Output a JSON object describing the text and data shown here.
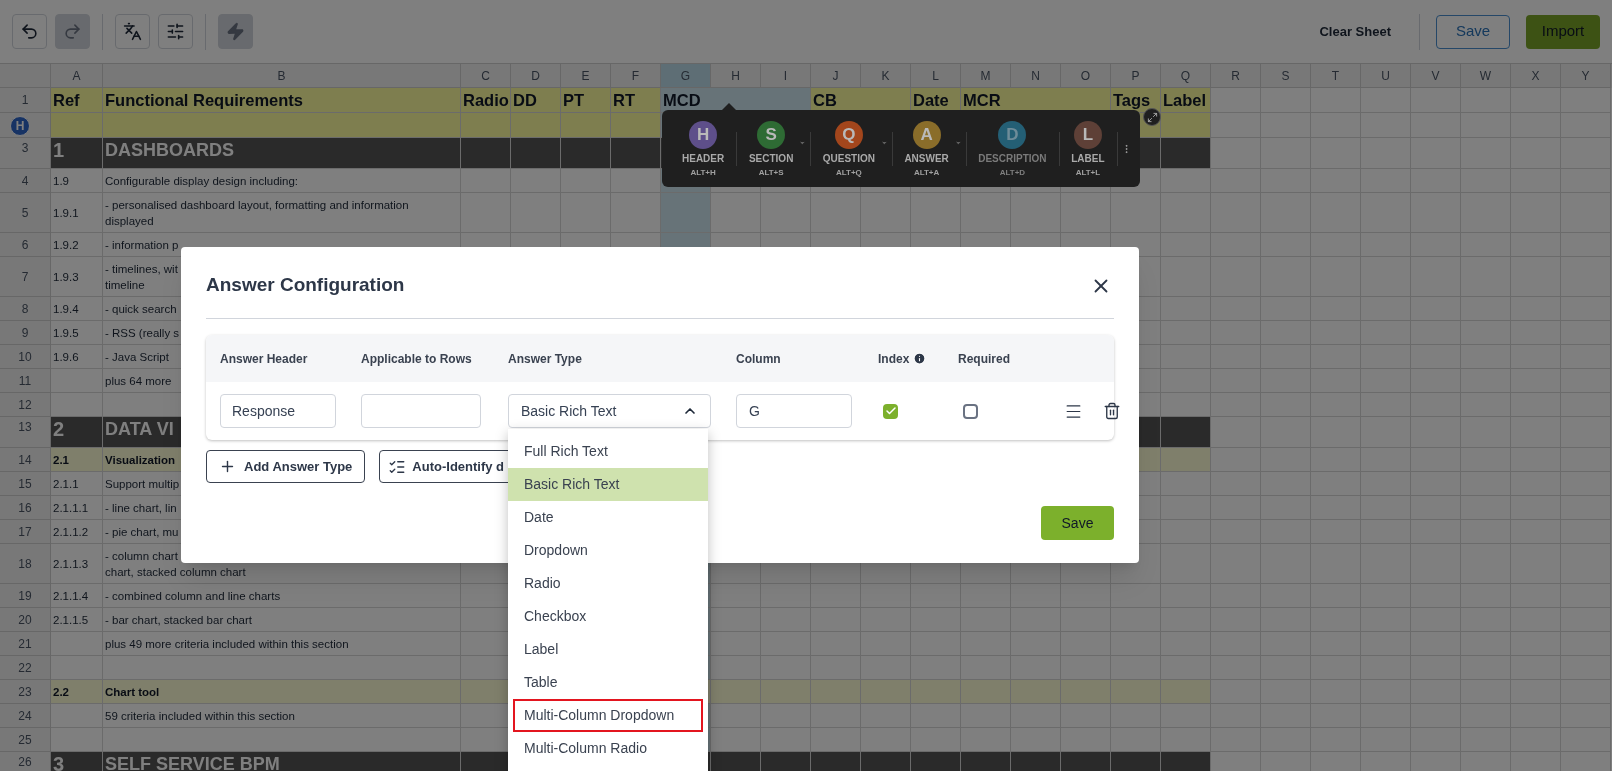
{
  "toolbar": {
    "tools": [
      {
        "kind": "undo",
        "disabled": false
      },
      {
        "kind": "redo",
        "disabled": true
      },
      {
        "kind": "translate",
        "disabled": false
      },
      {
        "kind": "settings",
        "disabled": false
      },
      {
        "kind": "automate",
        "disabled": true
      }
    ],
    "actions": [
      {
        "label": "Clear Sheet",
        "kind": "text"
      },
      {
        "label": "Save",
        "kind": "outline"
      },
      {
        "label": "Import",
        "kind": "primary"
      }
    ]
  },
  "spreadsheet": {
    "columns": [
      {
        "label": "A",
        "selected": false
      },
      {
        "label": "B",
        "selected": false
      },
      {
        "label": "C",
        "selected": false
      },
      {
        "label": "D",
        "selected": false
      },
      {
        "label": "E",
        "selected": false
      },
      {
        "label": "F",
        "selected": false
      },
      {
        "label": "G",
        "selected": true
      },
      {
        "label": "H",
        "selected": false
      },
      {
        "label": "I",
        "selected": false
      },
      {
        "label": "J",
        "selected": false
      },
      {
        "label": "K",
        "selected": false
      },
      {
        "label": "L",
        "selected": false
      },
      {
        "label": "M",
        "selected": false
      },
      {
        "label": "N",
        "selected": false
      },
      {
        "label": "O",
        "selected": false
      },
      {
        "label": "P",
        "selected": false
      },
      {
        "label": "Q",
        "selected": false
      },
      {
        "label": "R",
        "selected": false
      },
      {
        "label": "S",
        "selected": false
      },
      {
        "label": "T",
        "selected": false
      },
      {
        "label": "U",
        "selected": false
      },
      {
        "label": "V",
        "selected": false
      },
      {
        "label": "W",
        "selected": false
      },
      {
        "label": "X",
        "selected": false
      },
      {
        "label": "Y",
        "selected": false
      }
    ],
    "rows": [
      {
        "number": "1",
        "kind": "header",
        "ref": "Ref",
        "text": "Functional Requirements",
        "headings": [
          {
            "text": "Radio",
            "merged": false
          },
          {
            "text": "DD",
            "merged": false
          },
          {
            "text": "PT",
            "merged": false
          },
          {
            "text": "RT",
            "merged": false
          },
          {
            "text": "MCD",
            "merged": false
          },
          {
            "merged": true
          },
          {
            "merged": true
          },
          {
            "text": "CB",
            "merged": false
          },
          {
            "merged": true
          },
          {
            "text": "Date",
            "merged": false
          },
          {
            "text": "MCR",
            "merged": false
          },
          {
            "merged": true
          },
          {
            "merged": true
          },
          {
            "text": "Tags",
            "merged": false
          },
          {
            "text": "Label",
            "merged": false
          }
        ]
      },
      {
        "badge": "H",
        "kind": "header"
      },
      {
        "number": "3",
        "kind": "section",
        "ref": "1",
        "text": "DASHBOARDS"
      },
      {
        "number": "4",
        "kind": "item",
        "ref": "1.9",
        "text": "Configurable display design including:"
      },
      {
        "number": "5",
        "kind": "item",
        "ref": "1.9.1",
        "text": "- personalised dashboard layout, formatting and information displayed"
      },
      {
        "number": "6",
        "kind": "item",
        "ref": "1.9.2",
        "text": "- information p"
      },
      {
        "number": "7",
        "kind": "item",
        "ref": "1.9.3",
        "text": "- timelines, wit\ntimeline"
      },
      {
        "number": "8",
        "kind": "item",
        "ref": "1.9.4",
        "text": "- quick search"
      },
      {
        "number": "9",
        "kind": "item",
        "ref": "1.9.5",
        "text": "- RSS (really s"
      },
      {
        "number": "10",
        "kind": "item",
        "ref": "1.9.6",
        "text": "- Java Script"
      },
      {
        "number": "11",
        "kind": "item",
        "text": "plus 64 more"
      },
      {
        "number": "12",
        "kind": "blank"
      },
      {
        "number": "13",
        "kind": "section",
        "ref": "2",
        "text": "DATA VI"
      },
      {
        "number": "14",
        "kind": "group",
        "ref": "2.1",
        "text": "Visualization"
      },
      {
        "number": "15",
        "kind": "item",
        "ref": "2.1.1",
        "text": "Support multip"
      },
      {
        "number": "16",
        "kind": "item",
        "ref": "2.1.1.1",
        "text": "- line chart, lin"
      },
      {
        "number": "17",
        "kind": "item",
        "ref": "2.1.1.2",
        "text": "- pie chart, mu"
      },
      {
        "number": "18",
        "kind": "item",
        "ref": "2.1.1.3",
        "text": "- column chart\nchart, stacked column chart"
      },
      {
        "number": "19",
        "kind": "item",
        "ref": "2.1.1.4",
        "text": "- combined column and line charts"
      },
      {
        "number": "20",
        "kind": "item",
        "ref": "2.1.1.5",
        "text": "- bar chart, stacked bar chart"
      },
      {
        "number": "21",
        "kind": "item",
        "text": "plus 49 more criteria included within this section"
      },
      {
        "number": "22",
        "kind": "blank"
      },
      {
        "number": "23",
        "kind": "group",
        "ref": "2.2",
        "text": "Chart tool"
      },
      {
        "number": "24",
        "kind": "item",
        "text": "59 criteria included within this section"
      },
      {
        "number": "25",
        "kind": "blank"
      },
      {
        "number": "26",
        "kind": "section",
        "ref": "3",
        "text": "SELF SERVICE BPM"
      }
    ]
  },
  "palette": {
    "items": [
      {
        "letter": "H",
        "label": "HEADER",
        "shortcut": "ALT+H",
        "color": "#5e4f8a",
        "disabled": false,
        "has_menu": false
      },
      {
        "letter": "S",
        "label": "SECTION",
        "shortcut": "ALT+S",
        "color": "#2e6b34",
        "disabled": false,
        "has_menu": true
      },
      {
        "letter": "Q",
        "label": "QUESTION",
        "shortcut": "ALT+Q",
        "color": "#a3461c",
        "disabled": false,
        "has_menu": true
      },
      {
        "letter": "A",
        "label": "ANSWER",
        "shortcut": "ALT+A",
        "color": "#8a6d2a",
        "disabled": false,
        "has_menu": true
      },
      {
        "letter": "D",
        "label": "DESCRIPTION",
        "shortcut": "ALT+D",
        "color": "#245f75",
        "disabled": true,
        "has_menu": false
      },
      {
        "letter": "L",
        "label": "LABEL",
        "shortcut": "ALT+L",
        "color": "#5e4037",
        "disabled": false,
        "has_menu": false
      }
    ]
  },
  "dialog": {
    "title": "Answer Configuration",
    "columns": [
      {
        "label": "Answer Header"
      },
      {
        "label": "Applicable to Rows"
      },
      {
        "label": "Answer Type"
      },
      {
        "label": "Column"
      },
      {
        "label": "Index",
        "info": true
      },
      {
        "label": "Required"
      }
    ],
    "answers": [
      {
        "answer_header": "Response",
        "answer_type": "Basic Rich Text",
        "expanded": true,
        "column": "G",
        "index": true,
        "required": false
      }
    ],
    "buttons": [
      {
        "label": "Add Answer Type",
        "kind": "add"
      },
      {
        "label": "Auto-Identify d",
        "kind": "auto"
      }
    ],
    "save": "Save",
    "options": [
      {
        "label": "Full Rich Text",
        "selected": false,
        "highlighted": false
      },
      {
        "label": "Basic Rich Text",
        "selected": true,
        "highlighted": false
      },
      {
        "label": "Date",
        "selected": false,
        "highlighted": false
      },
      {
        "label": "Dropdown",
        "selected": false,
        "highlighted": false
      },
      {
        "label": "Radio",
        "selected": false,
        "highlighted": false
      },
      {
        "label": "Checkbox",
        "selected": false,
        "highlighted": false
      },
      {
        "label": "Label",
        "selected": false,
        "highlighted": false
      },
      {
        "label": "Table",
        "selected": false,
        "highlighted": false
      },
      {
        "label": "Multi-Column Dropdown",
        "selected": false,
        "highlighted": true
      },
      {
        "label": "Multi-Column Radio",
        "selected": false,
        "highlighted": false
      }
    ]
  }
}
